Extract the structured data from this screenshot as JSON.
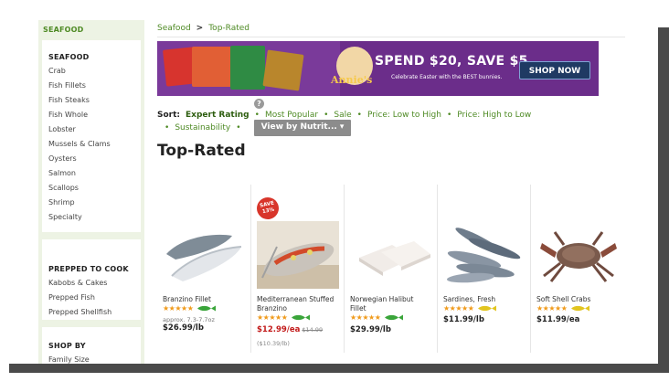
{
  "sidebar": {
    "header": "SEAFOOD",
    "sections": [
      {
        "title": "SEAFOOD",
        "items": [
          "Crab",
          "Fish Fillets",
          "Fish Steaks",
          "Fish Whole",
          "Lobster",
          "Mussels & Clams",
          "Oysters",
          "Salmon",
          "Scallops",
          "Shrimp",
          "Specialty"
        ]
      },
      {
        "title": "PREPPED TO COOK",
        "items": [
          "Kabobs & Cakes",
          "Prepped Fish",
          "Prepped Shellfish"
        ]
      },
      {
        "title": "SHOP BY",
        "items": [
          "Family Size"
        ]
      }
    ]
  },
  "breadcrumb": {
    "parent": "Seafood",
    "separator": ">",
    "current": "Top-Rated"
  },
  "banner": {
    "brand": "Annie's",
    "headline": "SPEND $20, SAVE $5",
    "subtext": "Celebrate Easter with the BEST bunnies.",
    "cta": "SHOP NOW"
  },
  "sort": {
    "label": "Sort:",
    "options": [
      "Expert Rating",
      "Most Popular",
      "Sale",
      "Price: Low to High",
      "Price: High to Low",
      "Sustainability"
    ],
    "active": "Expert Rating",
    "help_icon": "?",
    "nutrition_button": "View by Nutrit... ▾"
  },
  "page_title": "Top-Rated",
  "products": [
    {
      "name": "Branzino Fillet",
      "stars": "★★★★★",
      "approx": "approx. 7.3-7.7oz",
      "price": "$26.99/lb",
      "fish_color": "#3aa53a"
    },
    {
      "name": "Mediterranean Stuffed Branzino",
      "line1": "Mediterranean Stuffed",
      "line2": "Branzino",
      "stars": "★★★★★",
      "sale_badge": "SAVE 13%",
      "price": "$12.99/ea",
      "was_price": "$14.99",
      "unit_price": "($10.39/lb)",
      "fish_color": "#3aa53a"
    },
    {
      "name": "Norwegian Halibut Fillet",
      "line1": "Norwegian Halibut",
      "line2": "Fillet",
      "stars": "★★★★★",
      "price": "$29.99/lb",
      "fish_color": "#3aa53a"
    },
    {
      "name": "Sardines, Fresh",
      "stars": "★★★★★",
      "price": "$11.99/lb",
      "fish_color": "#e2c51f"
    },
    {
      "name": "Soft Shell Crabs",
      "stars": "★★★★★",
      "price": "$11.99/ea",
      "fish_color": "#e2c51f"
    }
  ],
  "colors": {
    "brand_green": "#4e8a24",
    "sidebar_bg": "#edf3e4",
    "banner_purple": "#6b2d8a",
    "sale_red": "#c21a1a",
    "star_orange": "#f09a1a"
  }
}
